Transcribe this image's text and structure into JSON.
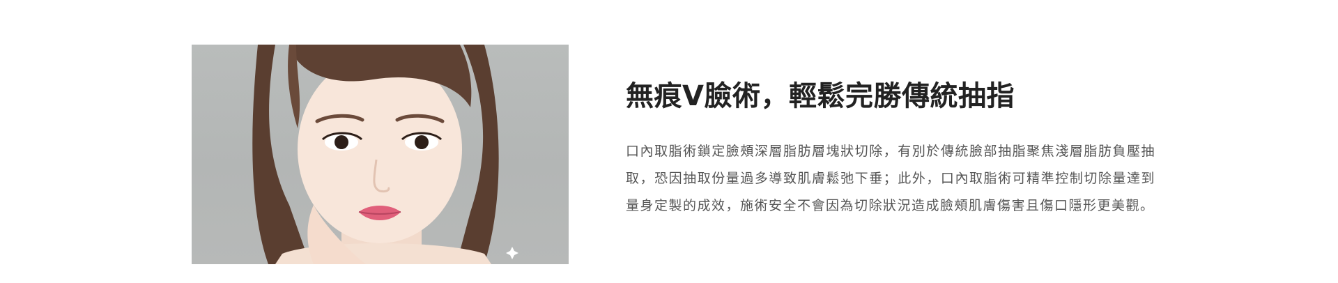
{
  "feature": {
    "image": {
      "icon": "portrait-photo",
      "background_color": "#b5b8b7"
    },
    "title": "無痕V臉術，輕鬆完勝傳統抽指",
    "description": "口內取脂術鎖定臉頰深層脂肪層塊狀切除，有別於傳統臉部抽脂聚焦淺層脂肪負壓抽取，恐因抽取份量過多導致肌膚鬆弛下垂；此外，口內取脂術可精準控制切除量達到量身定製的成效，施術安全不會因為切除狀況造成臉頰肌膚傷害且傷口隱形更美觀。",
    "text_colors": {
      "title": "#222222",
      "body": "#555555"
    }
  }
}
